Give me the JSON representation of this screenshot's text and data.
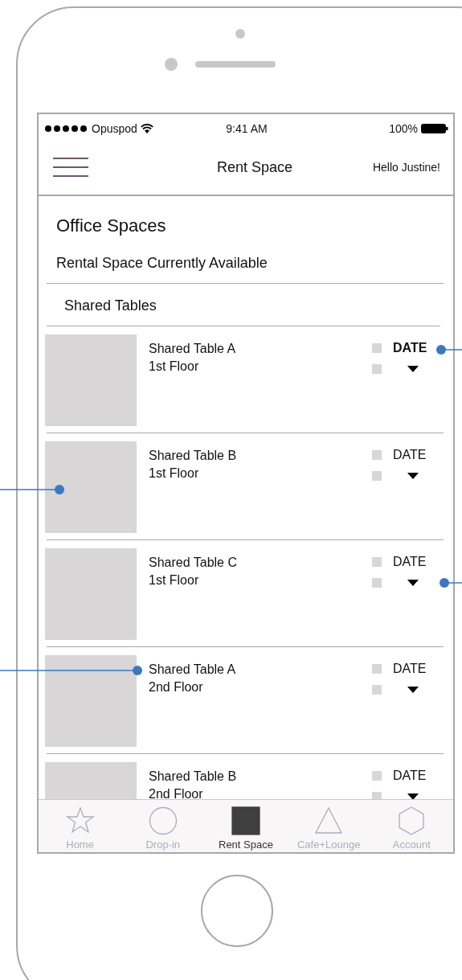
{
  "status_bar": {
    "carrier": "Opuspod",
    "time": "9:41 AM",
    "battery": "100%"
  },
  "nav_bar": {
    "title": "Rent Space",
    "greeting": "Hello Justine!"
  },
  "page_title": "Office Spaces",
  "subtitle": "Rental Space Currently Available",
  "section": "Shared Tables",
  "rows": [
    {
      "name": "Shared Table A",
      "floor": "1st Floor",
      "date": "DATE",
      "selected": true
    },
    {
      "name": "Shared Table B",
      "floor": "1st Floor",
      "date": "DATE",
      "selected": false
    },
    {
      "name": "Shared Table C",
      "floor": "1st Floor",
      "date": "DATE",
      "selected": false
    },
    {
      "name": "Shared Table A",
      "floor": "2nd Floor",
      "date": "DATE",
      "selected": false
    },
    {
      "name": "Shared Table B",
      "floor": "2nd Floor",
      "date": "DATE",
      "selected": false
    }
  ],
  "tabs": [
    {
      "label": "Home",
      "selected": false
    },
    {
      "label": "Drop-in",
      "selected": false
    },
    {
      "label": "Rent Space",
      "selected": true
    },
    {
      "label": "Cafe+Lounge",
      "selected": false
    },
    {
      "label": "Account",
      "selected": false
    }
  ]
}
